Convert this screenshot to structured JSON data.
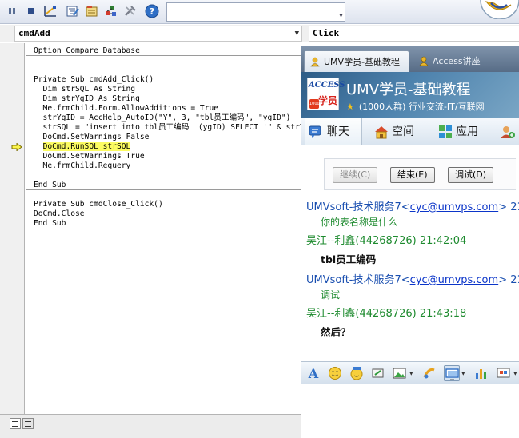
{
  "editor": {
    "object_combo": "cmdAdd",
    "procedure_combo": "Click",
    "code_lines": [
      "Option Compare Database",
      "",
      "",
      "Private Sub cmdAdd_Click()",
      "  Dim strSQL As String",
      "  Dim strYgID As String",
      "  Me.frmChild.Form.AllowAdditions = True",
      "  strYgID = AccHelp_AutoID(\"Y\", 3, \"tbl员工编码\", \"ygID\")",
      "  strSQL = \"insert into tbl员工编码  (ygID) SELECT '\" & strYgID & \"'\"",
      "  DoCmd.SetWarnings False",
      "  DoCmd.RunSQL strSQL",
      "  DoCmd.SetWarnings True",
      "  Me.frmChild.Requery",
      "",
      "End Sub",
      "",
      "Private Sub cmdClose_Click()",
      "DoCmd.Close",
      "End Sub"
    ],
    "highlighted_line": "DoCmd.RunSQL strSQL"
  },
  "chat": {
    "tabs": [
      {
        "label": "UMV学员-基础教程",
        "active": true
      },
      {
        "label": "Access讲座",
        "active": false
      }
    ],
    "logo": {
      "line1": "ACCESS",
      "line2": "学员",
      "badge": "1000"
    },
    "group_title": "UMV学员-基础教程",
    "group_subtitle": "(1000人群) 行业交流-IT/互联网",
    "nav": {
      "chat": "聊天",
      "space": "空间",
      "apps": "应用"
    },
    "debug_buttons": {
      "continue": "继续(C)",
      "end": "结束(E)",
      "debug": "调试(D)"
    },
    "messages": [
      {
        "sender": "UMVsoft-技术服务7",
        "email": "cyc@umvps.com",
        "suffix": "> 21",
        "text": "你的表名称是什么",
        "color": "blue"
      },
      {
        "sender": "吴江--利鑫(44268726)",
        "time": "21:42:04",
        "text": "tbl员工编码",
        "color": "green"
      },
      {
        "sender": "UMVsoft-技术服务7",
        "email": "cyc@umvps.com",
        "suffix": "> 21",
        "text": "调试",
        "color": "blue"
      },
      {
        "sender": "吴江--利鑫(44268726)",
        "time": "21:43:18",
        "text": "然后？",
        "color": "green"
      }
    ],
    "colors": {
      "blue_sender": "#1a4fb0",
      "green_sender": "#1d8a2e",
      "header_bg": "#4d82ad"
    }
  },
  "icons": {
    "toolbar": [
      "pause-icon",
      "stop-icon",
      "design-mode-icon",
      "project-explorer-icon",
      "properties-icon",
      "object-browser-icon",
      "toolbox-icon",
      "help-icon"
    ],
    "chat_toolbar": [
      "font-icon",
      "smiley-icon",
      "magic-face-icon",
      "shake-icon",
      "image-icon",
      "music-icon",
      "screenshot-icon",
      "chart-icon",
      "more-icon"
    ]
  }
}
